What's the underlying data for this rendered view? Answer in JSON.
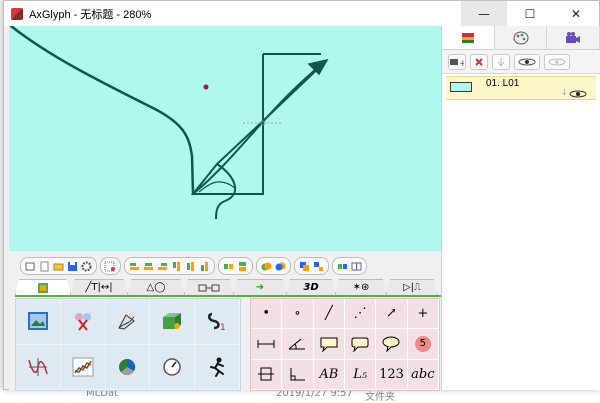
{
  "window": {
    "title": "AxGlyph - 无标题 - 280%",
    "minimize": "—",
    "maximize": "☐",
    "close": "✕"
  },
  "background": {
    "file_name": "MLDat",
    "file_date": "2019/1/27 9:57",
    "file_type": "文件夹"
  },
  "layers_panel": {
    "tabs": [
      {
        "icon": "layers-icon",
        "active": true
      },
      {
        "icon": "palette-icon",
        "active": false
      },
      {
        "icon": "camera-icon",
        "active": false
      }
    ],
    "layers": [
      {
        "label": "01. L01"
      }
    ]
  },
  "toolbar_tabs": [
    {
      "label": "",
      "icon": "image-tab-icon",
      "active": true
    },
    {
      "label": "╱T|↔|",
      "icon": "",
      "active": false
    },
    {
      "label": "△◯",
      "icon": "",
      "active": false
    },
    {
      "label": "",
      "icon": "connector-tab-icon",
      "active": false
    },
    {
      "label": "➜",
      "icon": "",
      "active": false
    },
    {
      "label": "3D",
      "icon": "",
      "active": false
    },
    {
      "label": "✶⊛",
      "icon": "",
      "active": false
    },
    {
      "label": "▷|⎍",
      "icon": "",
      "active": false
    }
  ],
  "symbol_grid": {
    "row1": [
      "•",
      "∘",
      "╱",
      "⋰",
      "↗",
      "+"
    ],
    "row3_text": [
      "AB",
      "L₅",
      "123",
      "abc"
    ],
    "badge": "5"
  },
  "colors": {
    "canvas": "#aff7ef",
    "stroke": "#10574a",
    "tab_accent": "#5cae3e",
    "layer_highlight": "#fdf6c9"
  }
}
